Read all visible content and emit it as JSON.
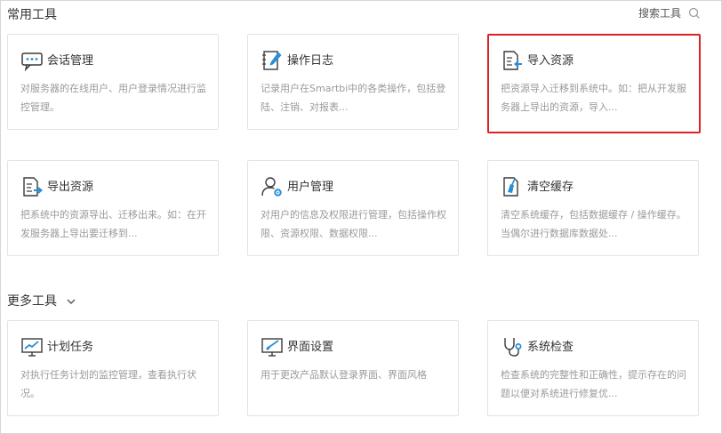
{
  "common_section": {
    "title": "常用工具"
  },
  "search": {
    "label": "搜索工具"
  },
  "more_section": {
    "title": "更多工具"
  },
  "cards": [
    {
      "title": "会话管理",
      "desc": "对服务器的在线用户、用户登录情况进行监控管理。",
      "icon": "chat-icon"
    },
    {
      "title": "操作日志",
      "desc": "记录用户在Smartbi中的各类操作，包括登陆、注销、对报表...",
      "icon": "notebook-pencil-icon"
    },
    {
      "title": "导入资源",
      "desc": "把资源导入迁移到系统中。如：把从开发服务器上导出的资源，导入...",
      "icon": "import-document-icon"
    },
    {
      "title": "导出资源",
      "desc": "把系统中的资源导出、迁移出来。如：在开发服务器上导出要迁移到...",
      "icon": "export-document-icon"
    },
    {
      "title": "用户管理",
      "desc": "对用户的信息及权限进行管理，包括操作权限、资源权限、数据权限...",
      "icon": "user-settings-icon"
    },
    {
      "title": "清空缓存",
      "desc": "清空系统缓存，包括数据缓存 / 操作缓存。当偶尔进行数据库数据处...",
      "icon": "clear-cache-icon"
    },
    {
      "title": "计划任务",
      "desc": "对执行任务计划的监控管理，查看执行状况。",
      "icon": "chart-monitor-icon"
    },
    {
      "title": "界面设置",
      "desc": "用于更改产品默认登录界面、界面风格",
      "icon": "paint-monitor-icon"
    },
    {
      "title": "系统检查",
      "desc": "检查系统的完整性和正确性，提示存在的问题以便对系统进行修复优...",
      "icon": "stethoscope-icon"
    }
  ],
  "colors": {
    "accent": "#2a8fd6",
    "selected_border": "#e02020",
    "icon_dark": "#3a3a3a"
  }
}
